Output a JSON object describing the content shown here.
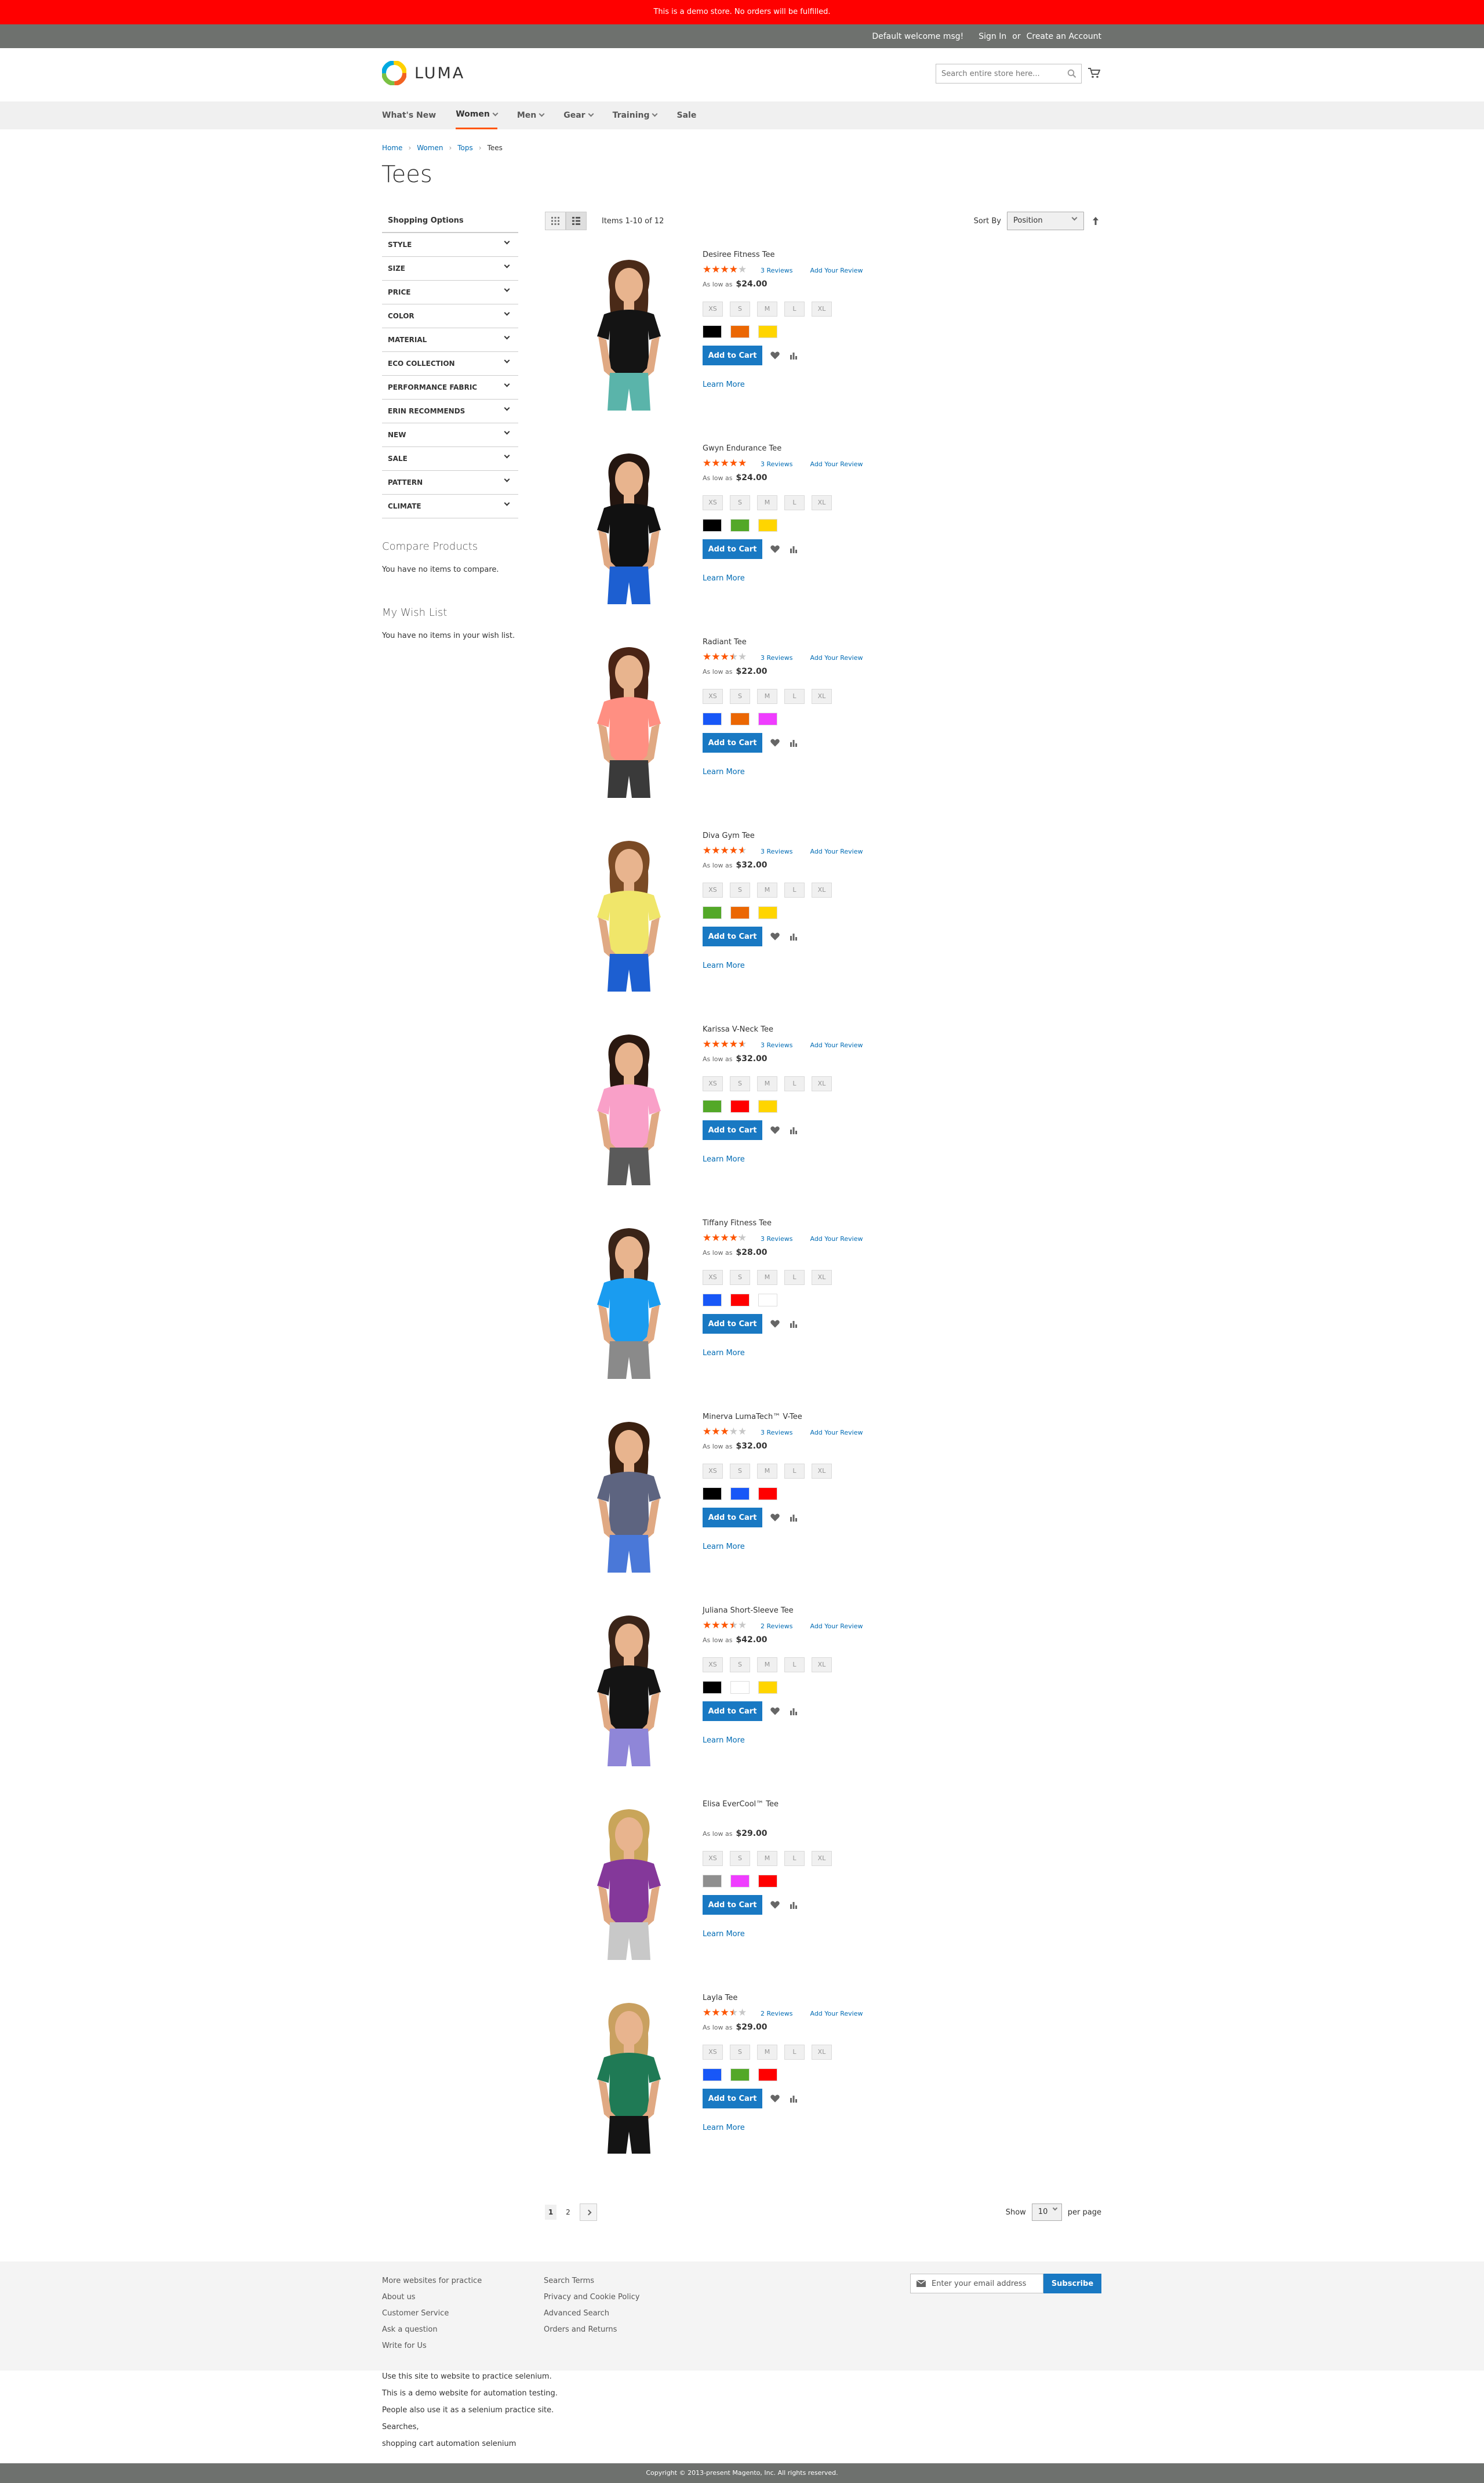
{
  "demo_notice": "This is a demo store. No orders will be fulfilled.",
  "top_links": {
    "welcome": "Default welcome msg!",
    "sign_in": "Sign In",
    "or": "or",
    "create_account": "Create an Account"
  },
  "logo": {
    "text": "LUMA"
  },
  "search": {
    "placeholder": "Search entire store here..."
  },
  "nav": [
    {
      "label": "What's New",
      "has_chevron": false
    },
    {
      "label": "Women",
      "has_chevron": true,
      "active": true
    },
    {
      "label": "Men",
      "has_chevron": true
    },
    {
      "label": "Gear",
      "has_chevron": true
    },
    {
      "label": "Training",
      "has_chevron": true
    },
    {
      "label": "Sale",
      "has_chevron": false
    }
  ],
  "breadcrumb": {
    "home": "Home",
    "women": "Women",
    "tops": "Tops",
    "current": "Tees"
  },
  "page_title": "Tees",
  "sidebar": {
    "shopping_options": "Shopping Options",
    "filters": [
      "STYLE",
      "SIZE",
      "PRICE",
      "COLOR",
      "MATERIAL",
      "ECO COLLECTION",
      "PERFORMANCE FABRIC",
      "ERIN RECOMMENDS",
      "NEW",
      "SALE",
      "PATTERN",
      "CLIMATE"
    ],
    "compare_title": "Compare Products",
    "compare_text": "You have no items to compare.",
    "wishlist_title": "My Wish List",
    "wishlist_text": "You have no items in your wish list."
  },
  "toolbar": {
    "amount": "Items 1-10 of 12",
    "sort_label": "Sort By",
    "sort_value": "Position"
  },
  "product_labels": {
    "as_low_as": "As low as",
    "add_review": "Add Your Review",
    "add_to_cart": "Add to Cart",
    "learn_more": "Learn More",
    "sizes": [
      "XS",
      "S",
      "M",
      "L",
      "XL"
    ]
  },
  "products": [
    {
      "name": "Desiree Fitness Tee",
      "rating": 70,
      "reviews": "3  Reviews",
      "price": "$24.00",
      "colors": [
        "#000000",
        "#eb6703",
        "#ffd500"
      ],
      "shirt": "#141414",
      "bottom": "#5ab4aa",
      "hair": "#4a2a18"
    },
    {
      "name": "Gwyn Endurance Tee",
      "rating": 87,
      "reviews": "3  Reviews",
      "price": "$24.00",
      "colors": [
        "#000000",
        "#53a828",
        "#ffd500"
      ],
      "shirt": "#111111",
      "bottom": "#1d5fd1",
      "hair": "#241610"
    },
    {
      "name": "Radiant Tee",
      "rating": 60,
      "reviews": "3  Reviews",
      "price": "$22.00",
      "colors": [
        "#1857f7",
        "#eb6703",
        "#ef3dff"
      ],
      "shirt": "#ff8f82",
      "bottom": "#3a3a3a",
      "hair": "#4a2415"
    },
    {
      "name": "Diva Gym Tee",
      "rating": 80,
      "reviews": "3  Reviews",
      "price": "$32.00",
      "colors": [
        "#53a828",
        "#eb6703",
        "#ffd500"
      ],
      "shirt": "#f0e66a",
      "bottom": "#1d5fd1",
      "hair": "#7a4a25"
    },
    {
      "name": "Karissa V-Neck Tee",
      "rating": 80,
      "reviews": "3  Reviews",
      "price": "$32.00",
      "colors": [
        "#53a828",
        "#ff0000",
        "#ffd500"
      ],
      "shirt": "#f9a0c8",
      "bottom": "#5a5a5a",
      "hair": "#2a1810"
    },
    {
      "name": "Tiffany Fitness Tee",
      "rating": 73,
      "reviews": "3  Reviews",
      "price": "$28.00",
      "colors": [
        "#1857f7",
        "#ff0000",
        "#ffffff"
      ],
      "shirt": "#1a9cf0",
      "bottom": "#8a8a8a",
      "hair": "#3a2418"
    },
    {
      "name": "Minerva LumaTech™ V-Tee",
      "rating": 53,
      "reviews": "3  Reviews",
      "price": "$32.00",
      "colors": [
        "#000000",
        "#1857f7",
        "#ff0000"
      ],
      "shirt": "#5d6480",
      "bottom": "#4a78d8",
      "hair": "#3a2010"
    },
    {
      "name": "Juliana Short-Sleeve Tee",
      "rating": 60,
      "reviews": "2  Reviews",
      "price": "$42.00",
      "colors": [
        "#000000",
        "#ffffff",
        "#ffd500"
      ],
      "shirt": "#141414",
      "bottom": "#8f86d8",
      "hair": "#3a2418"
    },
    {
      "name": "Elisa EverCool™ Tee",
      "rating": null,
      "reviews": null,
      "price": "$29.00",
      "colors": [
        "#8f8f8f",
        "#ef3dff",
        "#ff0000"
      ],
      "shirt": "#84389a",
      "bottom": "#c8c8c8",
      "hair": "#c9a55a"
    },
    {
      "name": "Layla Tee",
      "rating": 60,
      "reviews": "2  Reviews",
      "price": "$29.00",
      "colors": [
        "#1857f7",
        "#53a828",
        "#ff0000"
      ],
      "shirt": "#1f7a55",
      "bottom": "#141414",
      "hair": "#c9a060"
    }
  ],
  "pager": {
    "current": "1",
    "next_page": "2",
    "show": "Show",
    "limit": "10",
    "per_page": "per page"
  },
  "footer": {
    "col1": [
      "More websites for practice",
      "About us",
      "Customer Service",
      "Ask a question",
      "Write for Us"
    ],
    "col2": [
      "Search Terms",
      "Privacy and Cookie Policy",
      "Advanced Search",
      "Orders and Returns"
    ],
    "newsletter_placeholder": "Enter your email address",
    "subscribe": "Subscribe"
  },
  "footer_text": [
    "Use this site to website to practice selenium.",
    "This is a demo website for automation testing.",
    "People also use it as a selenium practice site.",
    "Searches,",
    "shopping cart automation selenium"
  ],
  "copyright": "Copyright © 2013-present Magento, Inc. All rights reserved.",
  "colors": {
    "accent": "#1979c3",
    "link": "#006bb4",
    "star": "#ff5501",
    "demo_bar": "#ff0000",
    "top_bar": "#6e716e"
  }
}
